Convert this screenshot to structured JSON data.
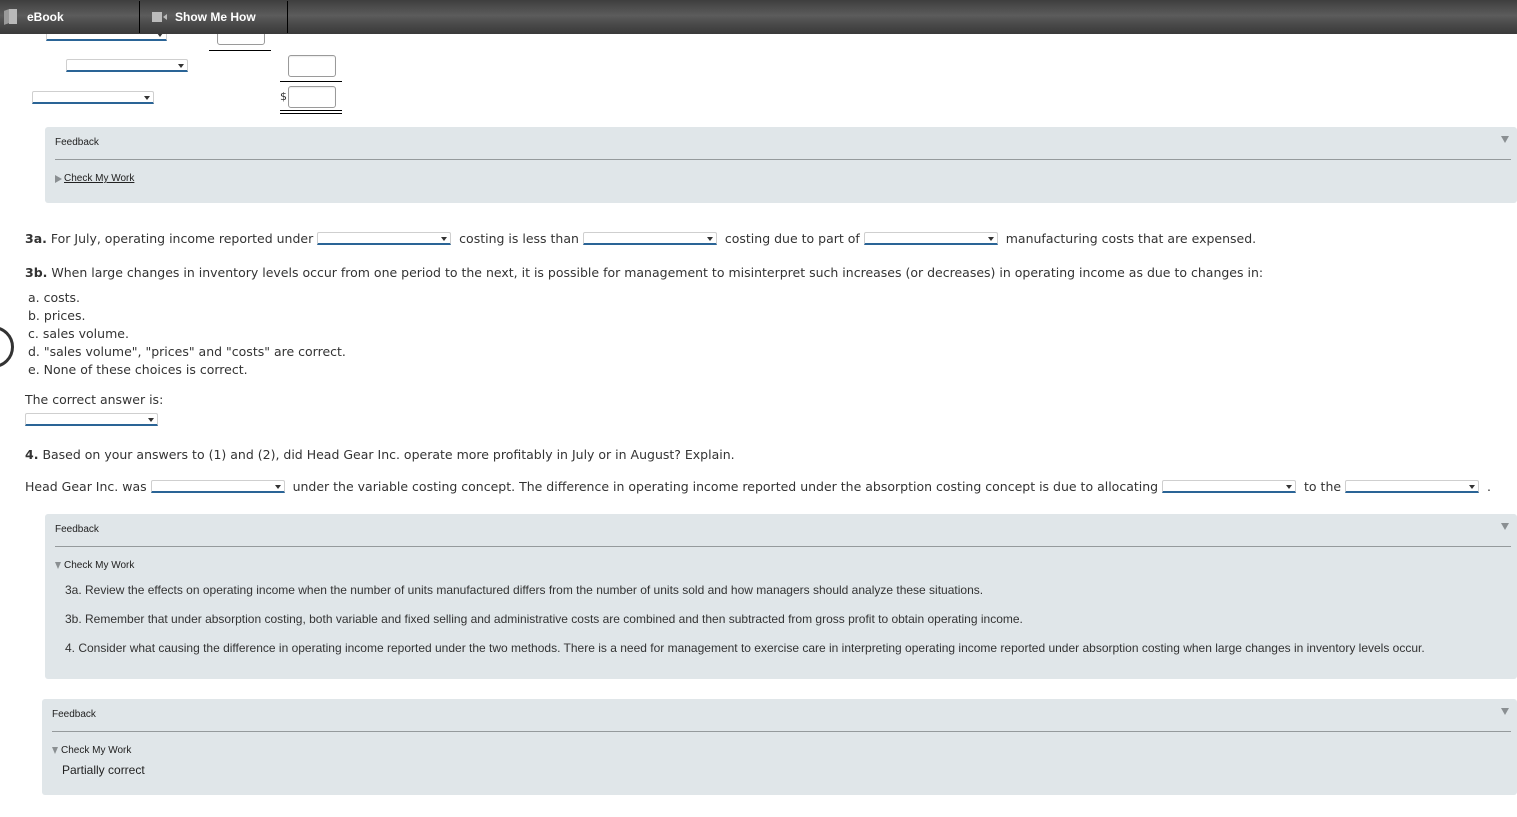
{
  "toolbar": {
    "ebook_label": "eBook",
    "show_me_how_label": "Show Me How"
  },
  "top_section": {
    "currency_symbol": "$"
  },
  "feedback_1": {
    "title": "Feedback",
    "check_my_work": "Check My Work"
  },
  "q3a": {
    "number": "3a.",
    "part1": "For July, operating income reported under",
    "part2": "costing is less than",
    "part3": "costing due to part of",
    "part4": "manufacturing costs that are expensed."
  },
  "q3b": {
    "number": "3b.",
    "text": "When large changes in inventory levels occur from one period to the next, it is possible for management to misinterpret such increases (or decreases) in operating income as due to changes in:",
    "options": [
      "a. costs.",
      "b. prices.",
      "c. sales volume.",
      "d. \"sales volume\", \"prices\" and \"costs\" are correct.",
      "e. None of these choices is correct."
    ],
    "answer_label": "The correct answer is:"
  },
  "q4": {
    "number": "4.",
    "text": "Based on your answers to (1) and (2), did Head Gear Inc. operate more profitably in July or in August? Explain.",
    "part1": "Head Gear Inc. was",
    "part2": "under the variable costing concept. The difference in operating income reported under the absorption costing concept is due to allocating",
    "part3": "to the",
    "part4": "."
  },
  "feedback_2": {
    "title": "Feedback",
    "check_my_work": "Check My Work",
    "hints": [
      "3a. Review the effects on operating income when the number of units manufactured differs from the number of units sold and how managers should analyze these situations.",
      "3b. Remember that under absorption costing, both variable and fixed selling and administrative costs are combined and then subtracted from gross profit to obtain operating income.",
      "4. Consider what causing the difference in operating income reported under the two methods. There is a need for management to exercise care in interpreting operating income reported under absorption costing when large changes in inventory levels occur."
    ]
  },
  "feedback_3": {
    "title": "Feedback",
    "check_my_work": "Check My Work",
    "status": "Partially correct"
  }
}
